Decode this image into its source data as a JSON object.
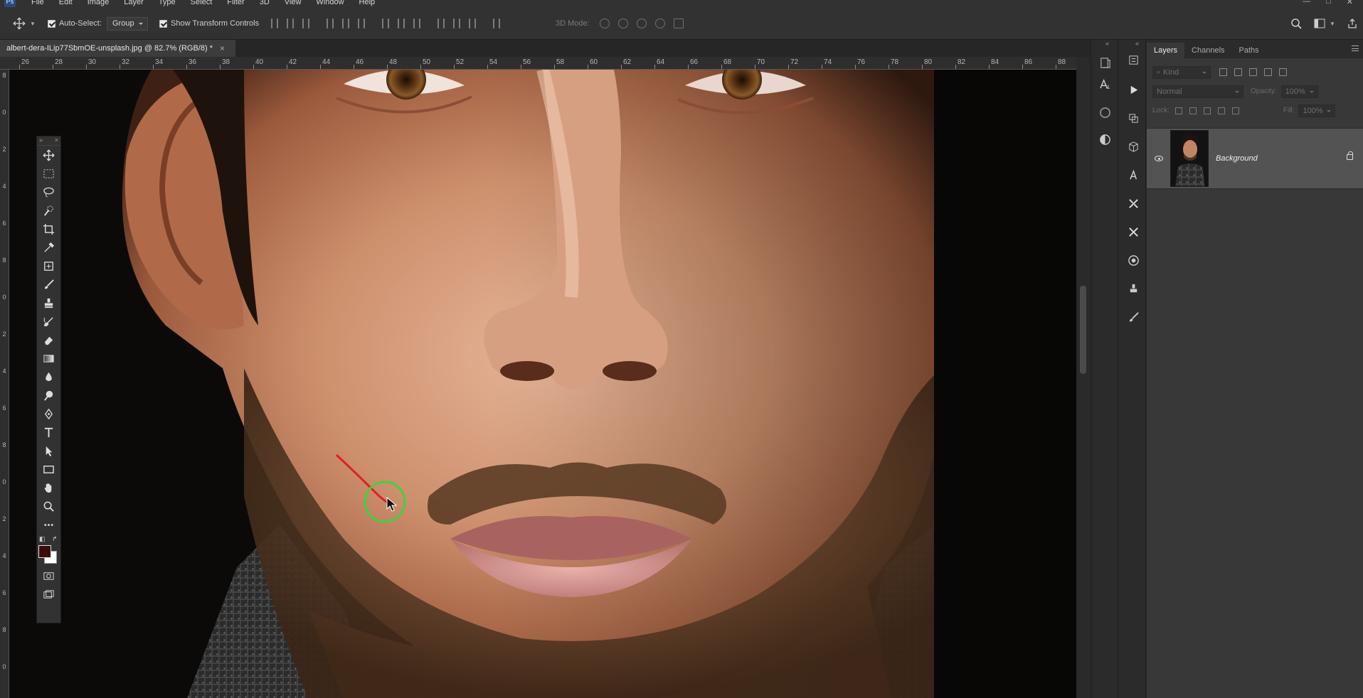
{
  "app": {
    "logo": "Ps",
    "menu": [
      "File",
      "Edit",
      "Image",
      "Layer",
      "Type",
      "Select",
      "Filter",
      "3D",
      "View",
      "Window",
      "Help"
    ],
    "window_controls": [
      "—",
      "□",
      "✕"
    ]
  },
  "options_bar": {
    "auto_select_label": "Auto-Select:",
    "auto_select_checked": true,
    "auto_select_target": "Group",
    "show_transform_label": "Show Transform Controls",
    "show_transform_checked": true,
    "mode_3d_label": "3D Mode:"
  },
  "document": {
    "tab_title": "albert-dera-ILip77SbmOE-unsplash.jpg @ 82.7% (RGB/8) *",
    "close_glyph": "×",
    "ruler_h": [
      "26",
      "28",
      "30",
      "32",
      "34",
      "36",
      "38",
      "40",
      "42",
      "44",
      "46",
      "48",
      "50",
      "52",
      "54",
      "56",
      "58",
      "60",
      "62",
      "64",
      "66",
      "68",
      "70",
      "72",
      "74",
      "76",
      "78",
      "80",
      "82",
      "84",
      "86",
      "88"
    ],
    "ruler_v": [
      "8",
      "0",
      "2",
      "4",
      "6",
      "8",
      "0",
      "2",
      "4",
      "6",
      "8",
      "0",
      "2",
      "4",
      "6",
      "8",
      "0"
    ]
  },
  "layers_panel": {
    "tabs": [
      "Layers",
      "Channels",
      "Paths"
    ],
    "active_tab": "Layers",
    "kind_label": "Kind",
    "blend_mode": "Normal",
    "opacity_label": "Opacity:",
    "opacity_value": "100%",
    "lock_label": "Lock:",
    "fill_label": "Fill:",
    "fill_value": "100%",
    "layers": [
      {
        "name": "Background",
        "visible": true,
        "locked": true
      }
    ]
  },
  "toolbox": {
    "foreground_color": "#3b0d06",
    "background_color": "#ffffff",
    "tools": [
      "move-tool",
      "marquee-tool",
      "lasso-tool",
      "quick-selection-tool",
      "crop-tool",
      "eyedropper-tool",
      "patch-tool",
      "brush-tool",
      "clone-stamp-tool",
      "history-brush-tool",
      "eraser-tool",
      "gradient-tool",
      "blur-tool",
      "dodge-tool",
      "pen-tool",
      "type-tool",
      "path-selection-tool",
      "rectangle-tool",
      "hand-tool",
      "zoom-tool",
      "more-tools"
    ]
  }
}
